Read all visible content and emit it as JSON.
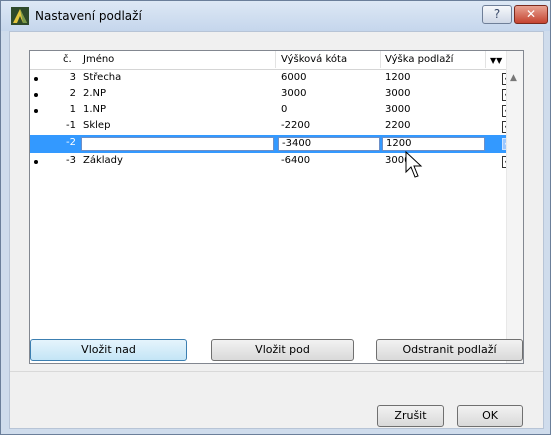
{
  "window": {
    "title": "Nastavení podlaží",
    "help_label": "?",
    "close_label": "✕"
  },
  "table": {
    "columns": [
      "č.",
      "Jméno",
      "Výšková kóta",
      "Výška podlaží",
      "▼▼"
    ],
    "rows": [
      {
        "dot": true,
        "num": "3",
        "name": "Střecha",
        "elev": "6000",
        "height": "1200",
        "checked": true
      },
      {
        "dot": true,
        "num": "2",
        "name": "2.NP",
        "elev": "3000",
        "height": "3000",
        "checked": true
      },
      {
        "dot": true,
        "num": "1",
        "name": "1.NP",
        "elev": "0",
        "height": "3000",
        "checked": true
      },
      {
        "dot": false,
        "num": "-1",
        "name": "Sklep",
        "elev": "-2200",
        "height": "2200",
        "checked": true
      },
      {
        "dot": false,
        "num": "-2",
        "name": "",
        "elev": "-3400",
        "height": "1200",
        "checked": true,
        "selected": true
      },
      {
        "dot": true,
        "num": "-3",
        "name": "Základy",
        "elev": "-6400",
        "height": "3000",
        "checked": true
      }
    ]
  },
  "buttons": {
    "insert_above": "Vložit nad",
    "insert_below": "Vložit pod",
    "remove": "Odstranit podlaží",
    "cancel": "Zrušit",
    "ok": "OK"
  },
  "colors": {
    "selection": "#3399ff",
    "title_bg": "#cfdcec",
    "close": "#c54330"
  },
  "icons": {
    "app": "archicad-icon",
    "scroll_up": "scroll-up-icon",
    "scroll_down": "scroll-down-icon",
    "check": "check-icon",
    "cursor": "mouse-pointer-icon"
  }
}
